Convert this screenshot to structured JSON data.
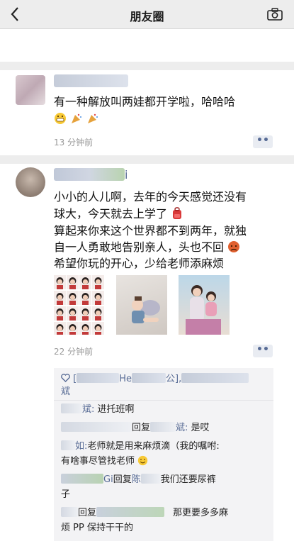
{
  "nav": {
    "title": "朋友圈"
  },
  "post1": {
    "text": "有一种解放叫两娃都开学啦，哈哈哈",
    "time": "13 分钟前",
    "more": "••"
  },
  "post2": {
    "name_suffix": "i",
    "lines": [
      "小小的人儿啊，去年的今天感觉还没有",
      "球大，今天就去上学了",
      "算起来你来这个世界都不到两年，就独",
      "自一人勇敢地告别亲人，头也不回",
      "希望你玩的开心，少给老师添麻烦"
    ],
    "time": "22 分钟前",
    "more": "••",
    "likes": {
      "prefix": "[",
      "mid": "He",
      "tail": "公],",
      "last": "斌"
    },
    "comments": [
      {
        "a_tail": "斌:",
        "text": "进托班啊"
      },
      {
        "reply": "回复",
        "b_tail": "斌:",
        "text": "是哎"
      },
      {
        "a_tail": "如:",
        "text": "老师就是用来麻烦滴（我的嘱咐:",
        "text2": "有啥事尽管找老师"
      },
      {
        "a_tail": "Gi",
        "reply": "回复",
        "b_mid": "陈",
        "text": "我们还要尿裤",
        "text2": "子"
      },
      {
        "reply": "回复",
        "text": "那更要多多麻",
        "text2": "烦 PP 保持干干的"
      }
    ]
  }
}
